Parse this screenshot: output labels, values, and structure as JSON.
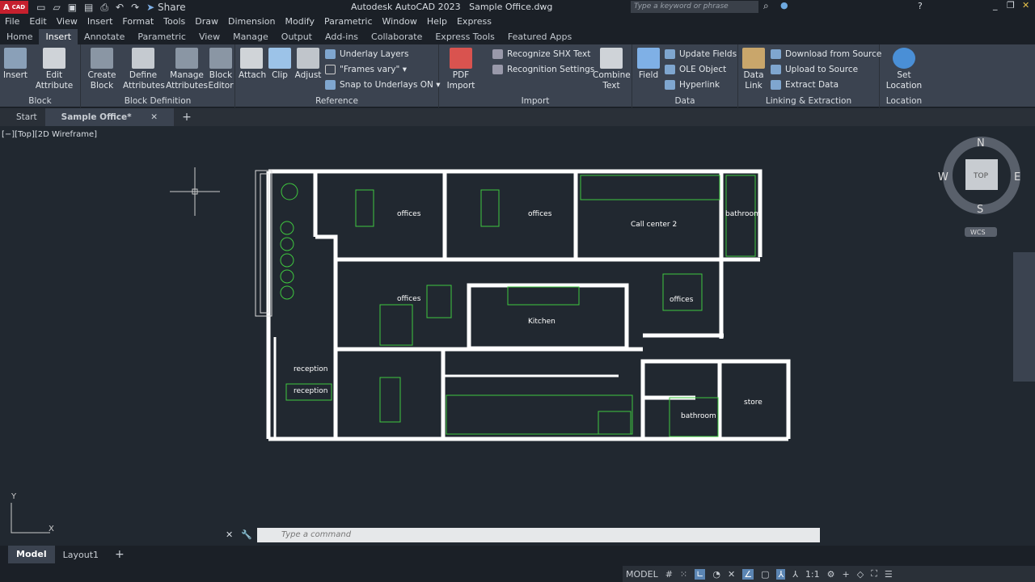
{
  "app": {
    "logo": "A",
    "logo_sub": "CAD",
    "title": "Autodesk AutoCAD 2023",
    "file": "Sample Office.dwg",
    "share": "Share",
    "search_placeholder": "Type a keyword or phrase"
  },
  "menu": [
    "File",
    "Edit",
    "View",
    "Insert",
    "Format",
    "Tools",
    "Draw",
    "Dimension",
    "Modify",
    "Parametric",
    "Window",
    "Help",
    "Express"
  ],
  "ribbon_tabs": [
    "Home",
    "Insert",
    "Annotate",
    "Parametric",
    "View",
    "Manage",
    "Output",
    "Add-ins",
    "Collaborate",
    "Express Tools",
    "Featured Apps"
  ],
  "active_tab": "Insert",
  "panels": {
    "block": {
      "title": "Block",
      "insert": "Insert",
      "edit_attribute": "Edit Attribute"
    },
    "block_def": {
      "title": "Block Definition",
      "create": "Create Block",
      "define": "Define Attributes",
      "manage": "Manage Attributes",
      "editor": "Block Editor"
    },
    "reference": {
      "title": "Reference",
      "attach": "Attach",
      "clip": "Clip",
      "adjust": "Adjust",
      "underlay_layers": "Underlay Layers",
      "frames": "\"Frames vary\"",
      "snap": "Snap to Underlays ON"
    },
    "import": {
      "title": "Import",
      "pdf": "PDF Import",
      "recognize": "Recognize SHX Text",
      "recognition_settings": "Recognition Settings",
      "combine": "Combine Text"
    },
    "data": {
      "title": "Data",
      "field": "Field",
      "update": "Update Fields",
      "ole": "OLE Object",
      "hyperlink": "Hyperlink"
    },
    "linking": {
      "title": "Linking & Extraction",
      "data_link": "Data Link",
      "download": "Download from Source",
      "upload": "Upload to Source",
      "extract": "Extract  Data"
    },
    "location": {
      "title": "Location",
      "set": "Set Location"
    }
  },
  "doc_tabs": {
    "start": "Start",
    "active": "Sample Office*"
  },
  "viewport": {
    "label": "[−][Top][2D Wireframe]",
    "rooms": [
      "offices",
      "offices",
      "Call center 2",
      "bathroom",
      "offices",
      "Kitchen",
      "offices",
      "reception",
      "reception",
      "bathroom",
      "store"
    ]
  },
  "viewcube": {
    "n": "N",
    "s": "S",
    "e": "E",
    "w": "W",
    "top": "TOP",
    "wcs": "WCS"
  },
  "ucs": {
    "x": "X",
    "y": "Y"
  },
  "command": {
    "placeholder": "Type a command"
  },
  "layout_tabs": [
    "Model",
    "Layout1"
  ],
  "status": {
    "model": "MODEL",
    "scale": "1:1"
  },
  "colors": {
    "walls": "#ffffff",
    "furniture": "#3fc83f",
    "background": "#212830",
    "accent": "#5b85b3"
  }
}
